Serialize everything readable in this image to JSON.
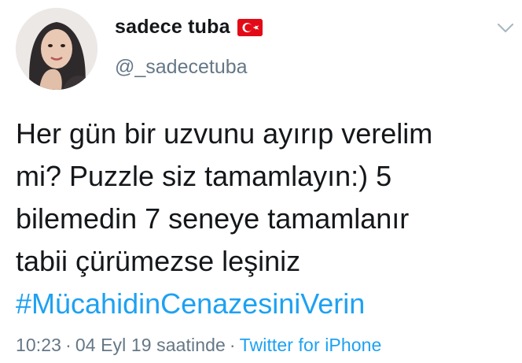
{
  "user": {
    "display_name": "sadece tuba",
    "flag_icon": "turkey-flag-icon",
    "handle": "@_sadecetuba"
  },
  "tweet": {
    "lines": [
      "Her gün bir uzvunu ayırıp verelim",
      "mi? Puzzle siz tamamlayın:) 5",
      "bilemedin 7 seneye tamamlanır",
      "tabii çürümezse leşiniz"
    ],
    "hashtag": "#MücahidinCenazesiniVerin"
  },
  "meta": {
    "time": "10:23",
    "separator": "·",
    "date": "04 Eyl 19 saatinde",
    "source": "Twitter for iPhone"
  },
  "colors": {
    "text": "#14171a",
    "secondary": "#657786",
    "link": "#1da1f2",
    "flag_red": "#e30a17"
  }
}
